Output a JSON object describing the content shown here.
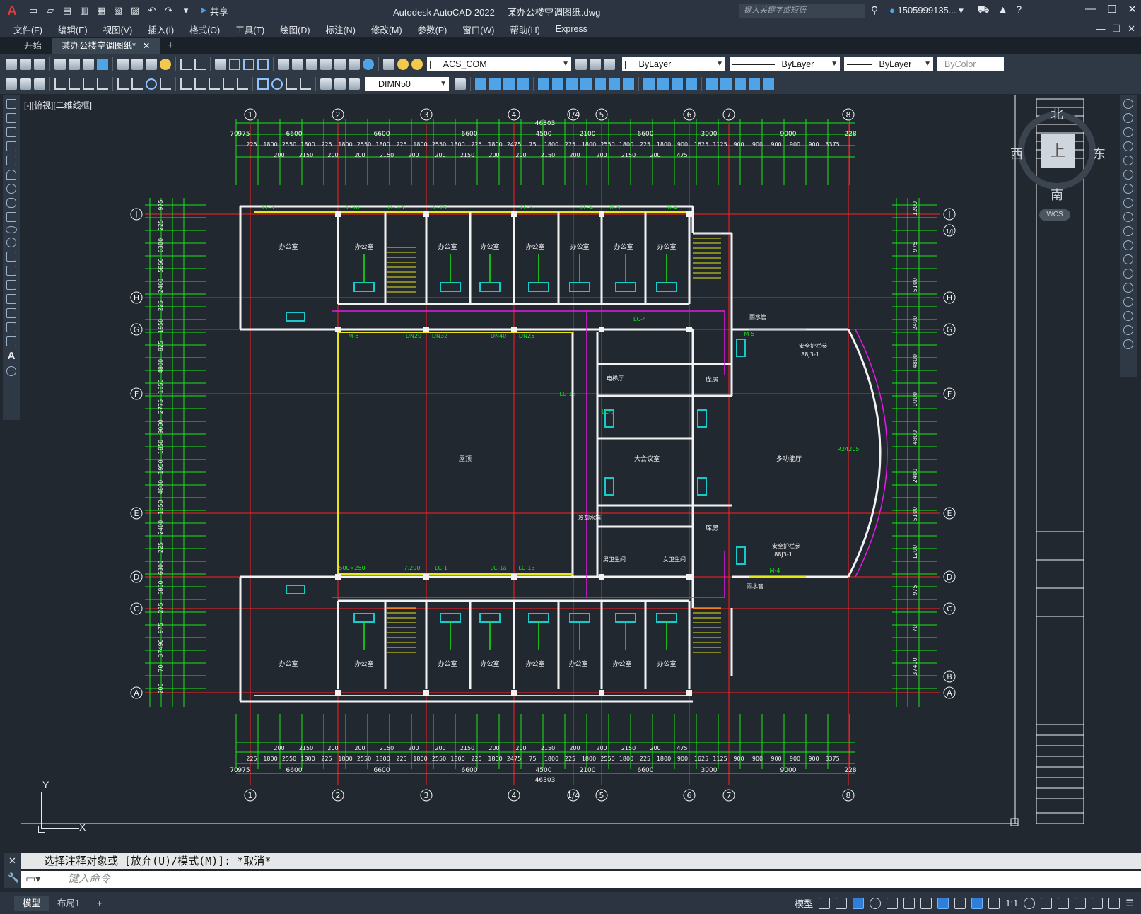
{
  "app": {
    "title": "Autodesk AutoCAD 2022",
    "filename": "某办公楼空调图纸.dwg",
    "search_placeholder": "键入关键字或短语",
    "user": "1505999135...",
    "share_label": "共享",
    "logo": "A"
  },
  "menu": [
    "文件(F)",
    "编辑(E)",
    "视图(V)",
    "插入(I)",
    "格式(O)",
    "工具(T)",
    "绘图(D)",
    "标注(N)",
    "修改(M)",
    "参数(P)",
    "窗口(W)",
    "帮助(H)",
    "Express"
  ],
  "tabs": {
    "start": "开始",
    "active": "某办公楼空调图纸*",
    "plus": "+"
  },
  "toolbar": {
    "layer": "ACS_COM",
    "color": "ByLayer",
    "linetype": "ByLayer",
    "lineweight": "ByLayer",
    "plotstyle": "ByColor",
    "dimstyle": "DIMN50"
  },
  "viewport": {
    "label": "[-][俯视][二维线框]",
    "cube": {
      "north": "北",
      "south": "南",
      "west": "西",
      "east": "东",
      "top": "上",
      "wcs": "WCS"
    },
    "ucs_x": "X",
    "ucs_y": "Y"
  },
  "command": {
    "history": "选择注释对象或 [放弃(U)/模式(M)]: *取消*",
    "placeholder": "键入命令"
  },
  "status": {
    "tabs": [
      "模型",
      "布局1",
      "+"
    ],
    "model_label": "模型",
    "scale": "1:1"
  },
  "drawing": {
    "grid_top": [
      "1",
      "2",
      "3",
      "4",
      "1/4",
      "5",
      "6",
      "7",
      "8"
    ],
    "grid_side_left": [
      "J",
      "H",
      "G",
      "F",
      "E",
      "D",
      "C",
      "A"
    ],
    "grid_side_right": [
      "J",
      "1/J",
      "H",
      "G",
      "F",
      "E",
      "D",
      "C",
      "B",
      "A"
    ],
    "overall_dim": "46303",
    "dims_top": [
      "975",
      "6600",
      "6600",
      "6600",
      "4500",
      "2100",
      "6600",
      "3000",
      "9000",
      "70",
      "228"
    ],
    "dims_top2": [
      "225",
      "1800",
      "2550",
      "1800",
      "225",
      "1800",
      "2550",
      "1800",
      "225",
      "1800",
      "2550",
      "1800",
      "225",
      "1800",
      "2475",
      "75",
      "1800",
      "225",
      "1800",
      "2550",
      "1800",
      "225",
      "1800",
      "900",
      "1625",
      "1125",
      "900",
      "900",
      "900",
      "900",
      "900",
      "3375"
    ],
    "dims_top3": [
      "200",
      "2150",
      "200",
      "200",
      "2150",
      "200",
      "200",
      "2150",
      "200",
      "200",
      "2150",
      "200",
      "200",
      "2150",
      "200",
      "475"
    ],
    "dims_left": [
      "975",
      "225",
      "6300",
      "5850",
      "2400",
      "225",
      "1950",
      "825",
      "4800",
      "1850",
      "2775",
      "9000",
      "1850",
      "1950",
      "4800",
      "1850",
      "2400",
      "225",
      "6300",
      "5850",
      "275",
      "975",
      "37490",
      "70",
      "200"
    ],
    "dims_right": [
      "1200",
      "975",
      "5100",
      "2400",
      "4800",
      "9000",
      "4800",
      "2400",
      "5100",
      "1200",
      "975",
      "70",
      "37490"
    ],
    "rooms": {
      "office": "办公室",
      "roof": "屋顶",
      "conf": "大会议室",
      "hall": "多功能厅",
      "store": "库房",
      "toilet_m": "男卫生间",
      "toilet_f": "女卫生间",
      "cool": "冷却水箱",
      "stair_sign": "安全护栏参",
      "stair_ref": "88J3-1",
      "rain": "雨水管",
      "elev": "电梯厅",
      "radius": "R24205"
    },
    "tags": [
      "LC-1",
      "LC-1a",
      "LC-13",
      "LC-15",
      "LC-3",
      "LC-4",
      "M-5",
      "M-4",
      "M-6",
      "DN20",
      "DN32",
      "DN40",
      "DN25",
      "500×250",
      "7.200"
    ]
  },
  "colors": {
    "grid_red": "#ff2020",
    "dim_green": "#19e619",
    "wall_white": "#f2f2f2",
    "window_yellow": "#e6e619",
    "duct_cyan": "#19c8c8",
    "pipe_magenta": "#e619e6",
    "background": "#212830"
  }
}
